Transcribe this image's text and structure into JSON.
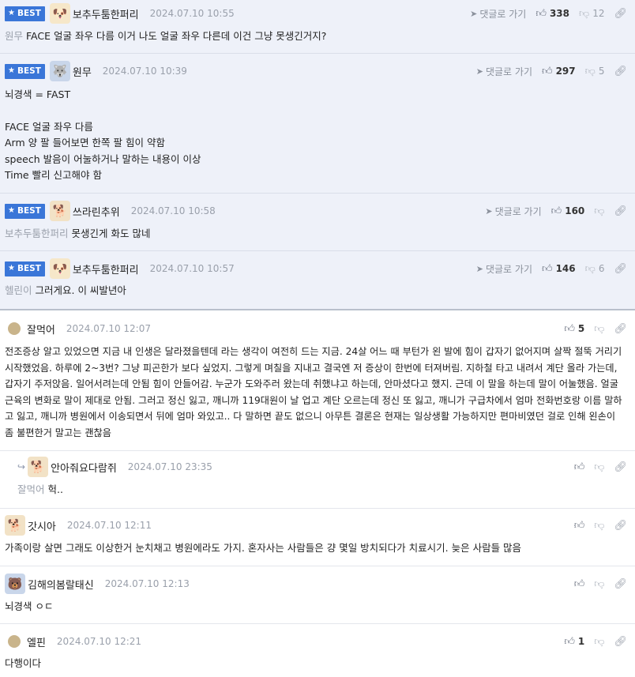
{
  "labels": {
    "best": "BEST",
    "goto": "댓글로 가기"
  },
  "colors": {
    "best_badge": "#3a76d8",
    "best_row_bg": "#eef1f9",
    "muted_text": "#9aa0ab"
  },
  "icons": {
    "thumb_up": "thumb-up-icon",
    "thumb_down": "thumb-down-icon",
    "link": "link-icon",
    "send": "send-icon",
    "reply": "reply-arrow-icon",
    "star": "star-icon"
  },
  "comments": [
    {
      "nick": "보추두툼한퍼리",
      "date": "2024.07.10 10:55",
      "up": "338",
      "down": "12",
      "mention": "원무",
      "text": "FACE 얼굴 좌우 다름 이거 나도 얼굴 좌우 다른데 이건 그냥 못생긴거지?"
    },
    {
      "nick": "원무",
      "date": "2024.07.10 10:39",
      "up": "297",
      "down": "5",
      "lines": [
        "뇌경색 = FAST",
        "FACE 얼굴 좌우 다름",
        "Arm 양 팔 들어보면 한쪽 팔 힘이 약함",
        "speech 발음이 어눌하거나 말하는 내용이 이상",
        "Time 빨리 신고해야 함"
      ]
    },
    {
      "nick": "쓰라린추위",
      "date": "2024.07.10 10:58",
      "up": "160",
      "down": "",
      "mention": "보추두툼한퍼리",
      "text": "못생긴게 화도 많네"
    },
    {
      "nick": "보추두툼한퍼리",
      "date": "2024.07.10 10:57",
      "up": "146",
      "down": "6",
      "mention": "헬린이",
      "text": "그러게요. 이 씨발년아"
    },
    {
      "nick": "잘먹어",
      "date": "2024.07.10 12:07",
      "up": "5",
      "down": "",
      "text": "전조증상 알고 있었으면 지금 내 인생은 달라졌을텐데 라는 생각이 여전히 드는 지금. 24살 어느 때 부턴가 왼 발에 힘이 갑자기 없어지며 살짝 절뚝 거리기 시작했었음. 하루에 2~3번? 그냥 피곤한가 보다 싶었지. 그렇게 며칠을 지내고 결국엔 저 증상이 한번에 터져버림. 지하철 타고 내려서 계단 올라 가는데, 갑자기 주저앉음. 일어서려는데 안됨 힘이 안들어감. 누군가 도와주러 왔는데 취했냐고 하는데, 안마셨다고 했지. 근데 이 말을 하는데 말이 어눌했음. 얼굴 근육의 변화로 말이 제대로 안됨. 그러고 정신 잃고, 깨니까 119대원이 날 업고 계단 오르는데 정신 또 잃고, 깨니가 구급차에서 엄마 전화번호랑 이름 말하고 잃고, 깨니까 병원에서 이송되면서 뒤에 엄마 와있고.. 다 말하면 끝도 없으니 아무튼 결론은 현재는 일상생활 가능하지만 편마비였던 걸로 인해 왼손이 좀 불편한거 말고는 괜찮음"
    },
    {
      "nick": "안아줘요다람쥐",
      "date": "2024.07.10 23:35",
      "up": "",
      "down": "",
      "mention": "잘먹어",
      "text": "헉.."
    },
    {
      "nick": "갓시아",
      "date": "2024.07.10 12:11",
      "up": "",
      "down": "",
      "text": "가족이랑 살면 그래도 이상한거 눈치채고 병원에라도 가지. 혼자사는 사람들은 걍 몇일 방치되다가 치료시기. 늦은 사람들 많음"
    },
    {
      "nick": "김해의봄랄태신",
      "date": "2024.07.10 12:13",
      "up": "",
      "down": "",
      "text": "뇌경색 ㅇㄷ"
    },
    {
      "nick": "엘핀",
      "date": "2024.07.10 12:21",
      "up": "1",
      "down": "",
      "text": "다행이다"
    }
  ]
}
